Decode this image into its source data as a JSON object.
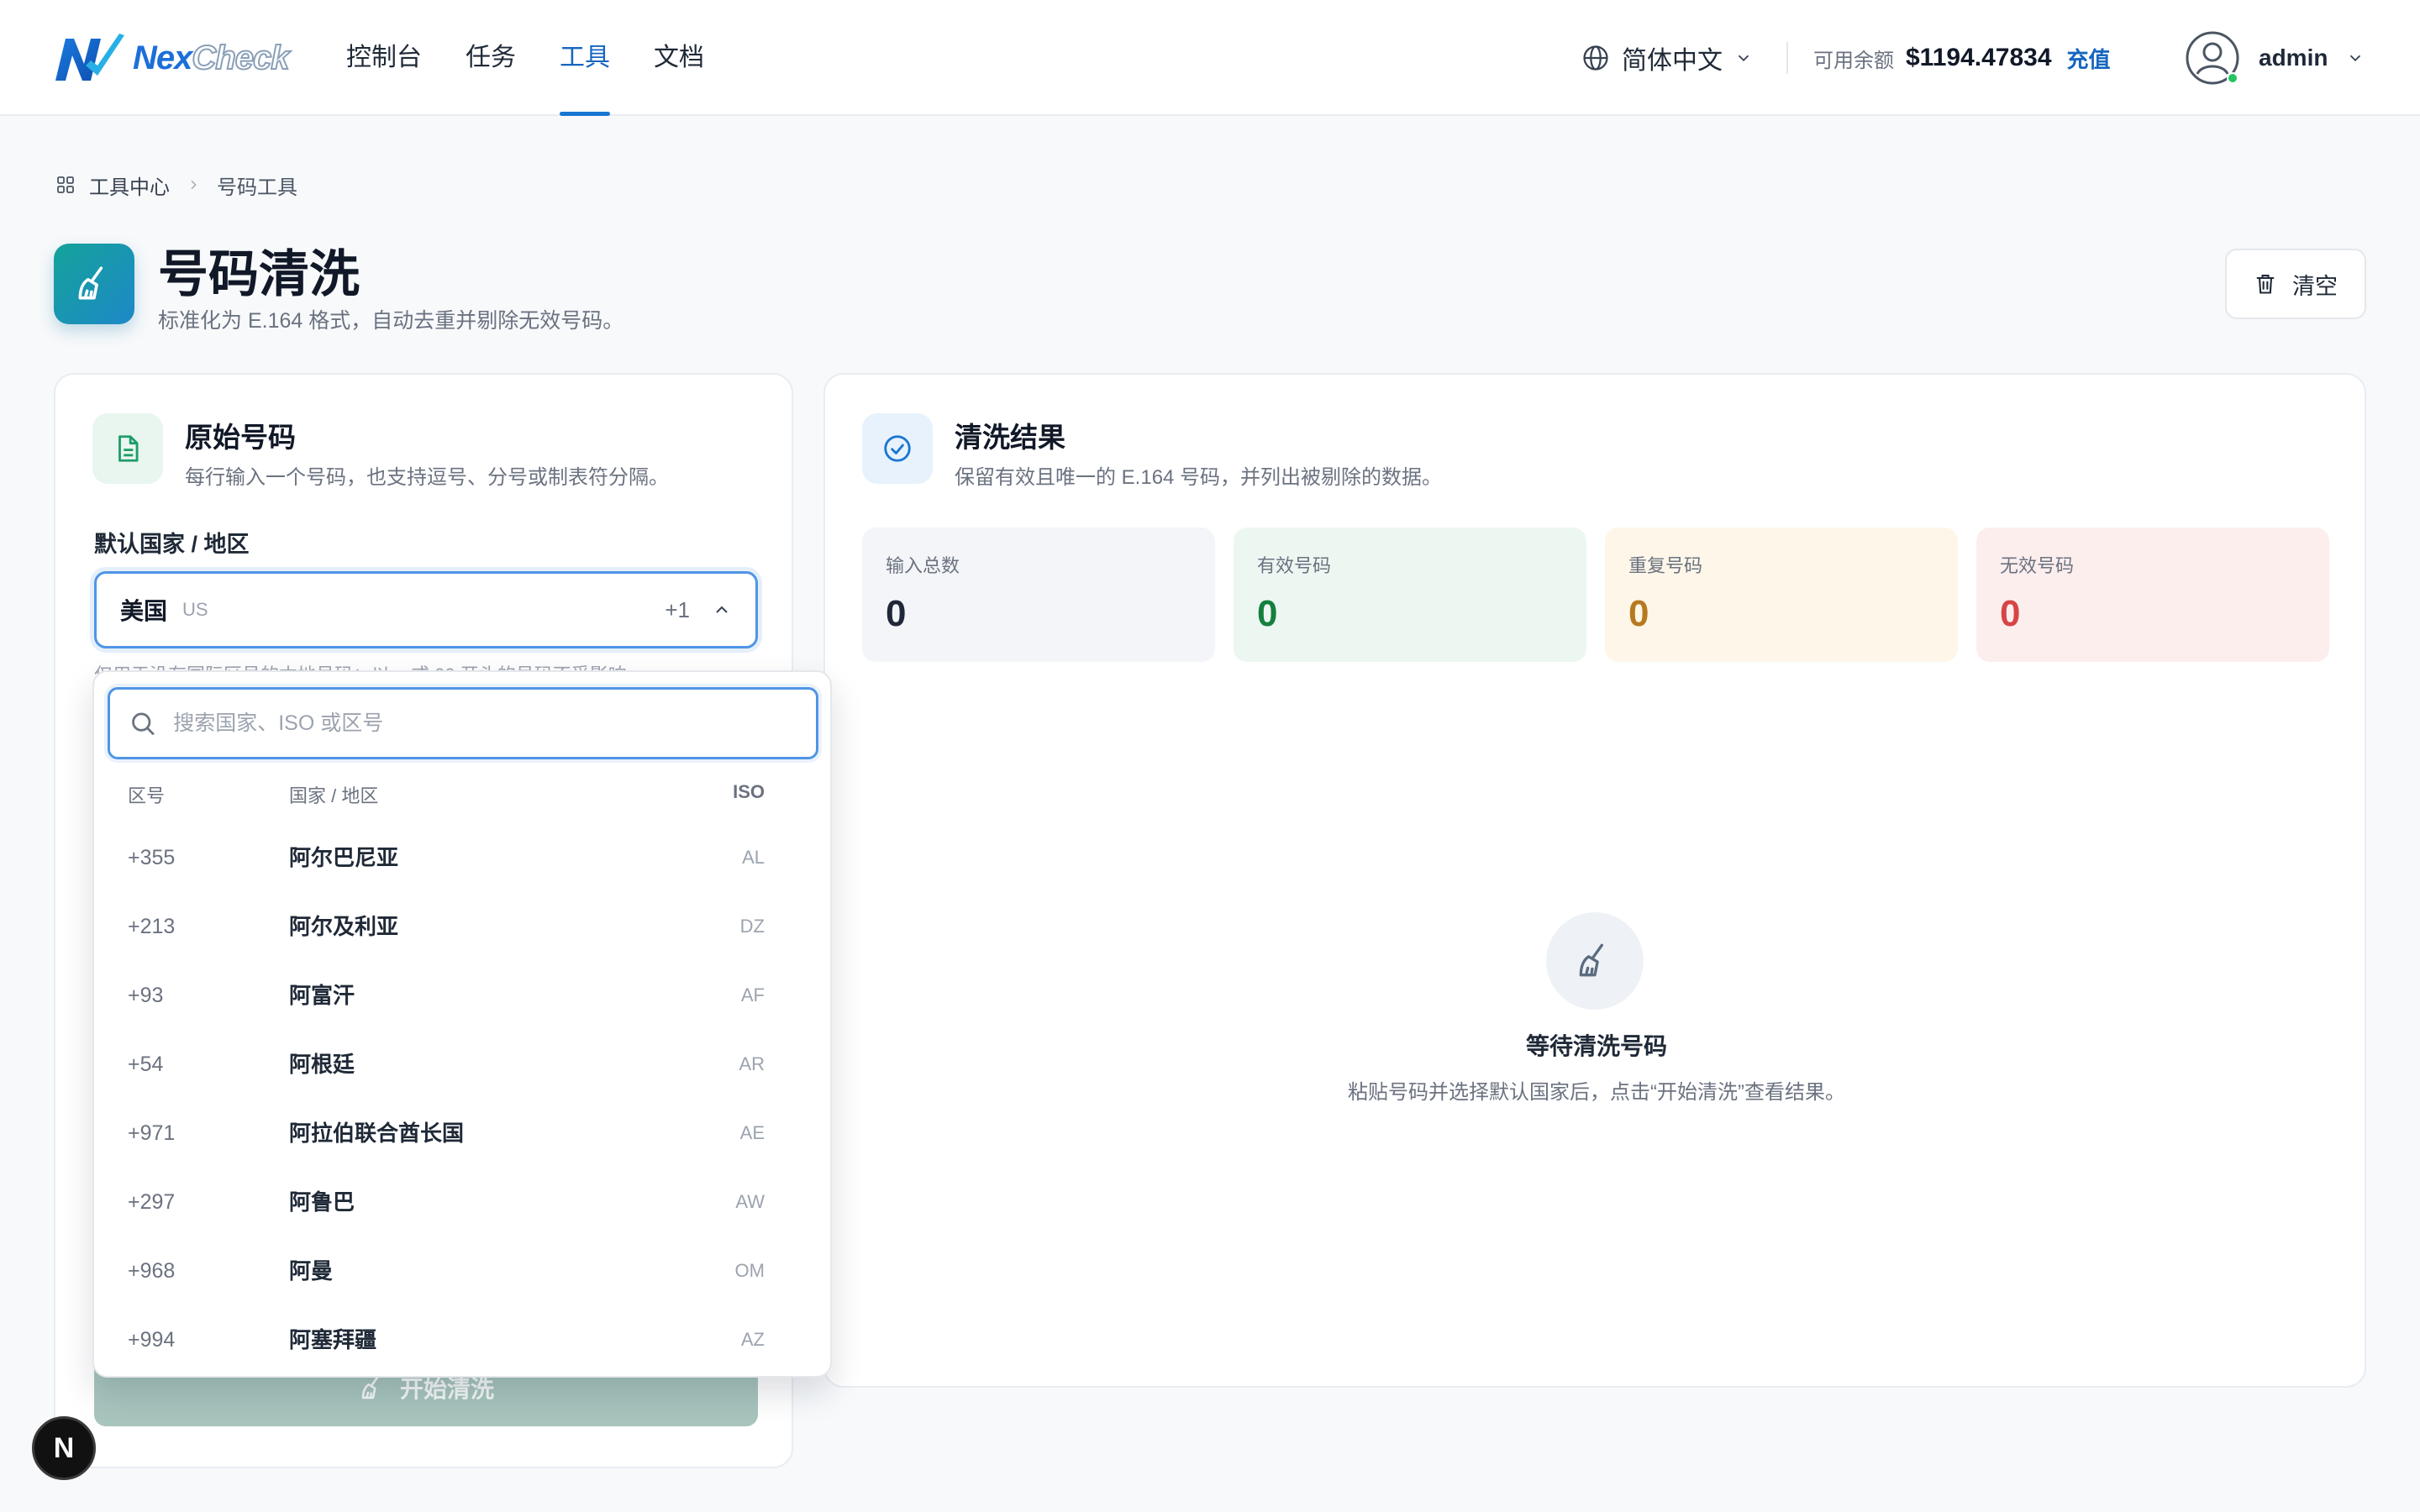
{
  "header": {
    "brand_a": "Nex",
    "brand_b": "Check",
    "nav": [
      {
        "label": "控制台"
      },
      {
        "label": "任务"
      },
      {
        "label": "工具"
      },
      {
        "label": "文档"
      }
    ],
    "active_nav": "工具",
    "language": "简体中文",
    "balance_label": "可用余额",
    "balance_amount": "$1194.47834",
    "recharge_label": "充值",
    "username": "admin"
  },
  "breadcrumb": {
    "root": "工具中心",
    "current": "号码工具"
  },
  "page": {
    "title": "号码清洗",
    "subtitle": "标准化为 E.164 格式，自动去重并剔除无效号码。",
    "clear_label": "清空"
  },
  "input_card": {
    "title": "原始号码",
    "subtitle": "每行输入一个号码，也支持逗号、分号或制表符分隔。",
    "country_label": "默认国家 / 地区",
    "selected_country": {
      "name": "美国",
      "iso": "US",
      "code": "+1"
    },
    "hint": "仅用于没有国际区号的本地号码；以 + 或 00 开头的号码不受影响。",
    "start_label": "开始清洗"
  },
  "country_dropdown": {
    "search_placeholder": "搜索国家、ISO 或区号",
    "col_code": "区号",
    "col_name": "国家 / 地区",
    "col_iso": "ISO",
    "items": [
      {
        "code": "+355",
        "name": "阿尔巴尼亚",
        "iso": "AL"
      },
      {
        "code": "+213",
        "name": "阿尔及利亚",
        "iso": "DZ"
      },
      {
        "code": "+93",
        "name": "阿富汗",
        "iso": "AF"
      },
      {
        "code": "+54",
        "name": "阿根廷",
        "iso": "AR"
      },
      {
        "code": "+971",
        "name": "阿拉伯联合酋长国",
        "iso": "AE"
      },
      {
        "code": "+297",
        "name": "阿鲁巴",
        "iso": "AW"
      },
      {
        "code": "+968",
        "name": "阿曼",
        "iso": "OM"
      },
      {
        "code": "+994",
        "name": "阿塞拜疆",
        "iso": "AZ"
      }
    ]
  },
  "result_card": {
    "title": "清洗结果",
    "subtitle": "保留有效且唯一的 E.164 号码，并列出被剔除的数据。",
    "stats": [
      {
        "label": "输入总数",
        "value": "0",
        "color": "#1f2937",
        "bg": "#f3f5f8"
      },
      {
        "label": "有效号码",
        "value": "0",
        "color": "#15803d",
        "bg": "#edf7f2"
      },
      {
        "label": "重复号码",
        "value": "0",
        "color": "#b7791f",
        "bg": "#fdf6e9"
      },
      {
        "label": "无效号码",
        "value": "0",
        "color": "#d64545",
        "bg": "#fdeeee"
      }
    ],
    "empty_title": "等待清洗号码",
    "empty_subtitle": "粘贴号码并选择默认国家后，点击“开始清洗”查看结果。"
  },
  "dev_badge": "N",
  "colors": {
    "accent": "#1976d2",
    "primary_teal": "#14a39a"
  }
}
